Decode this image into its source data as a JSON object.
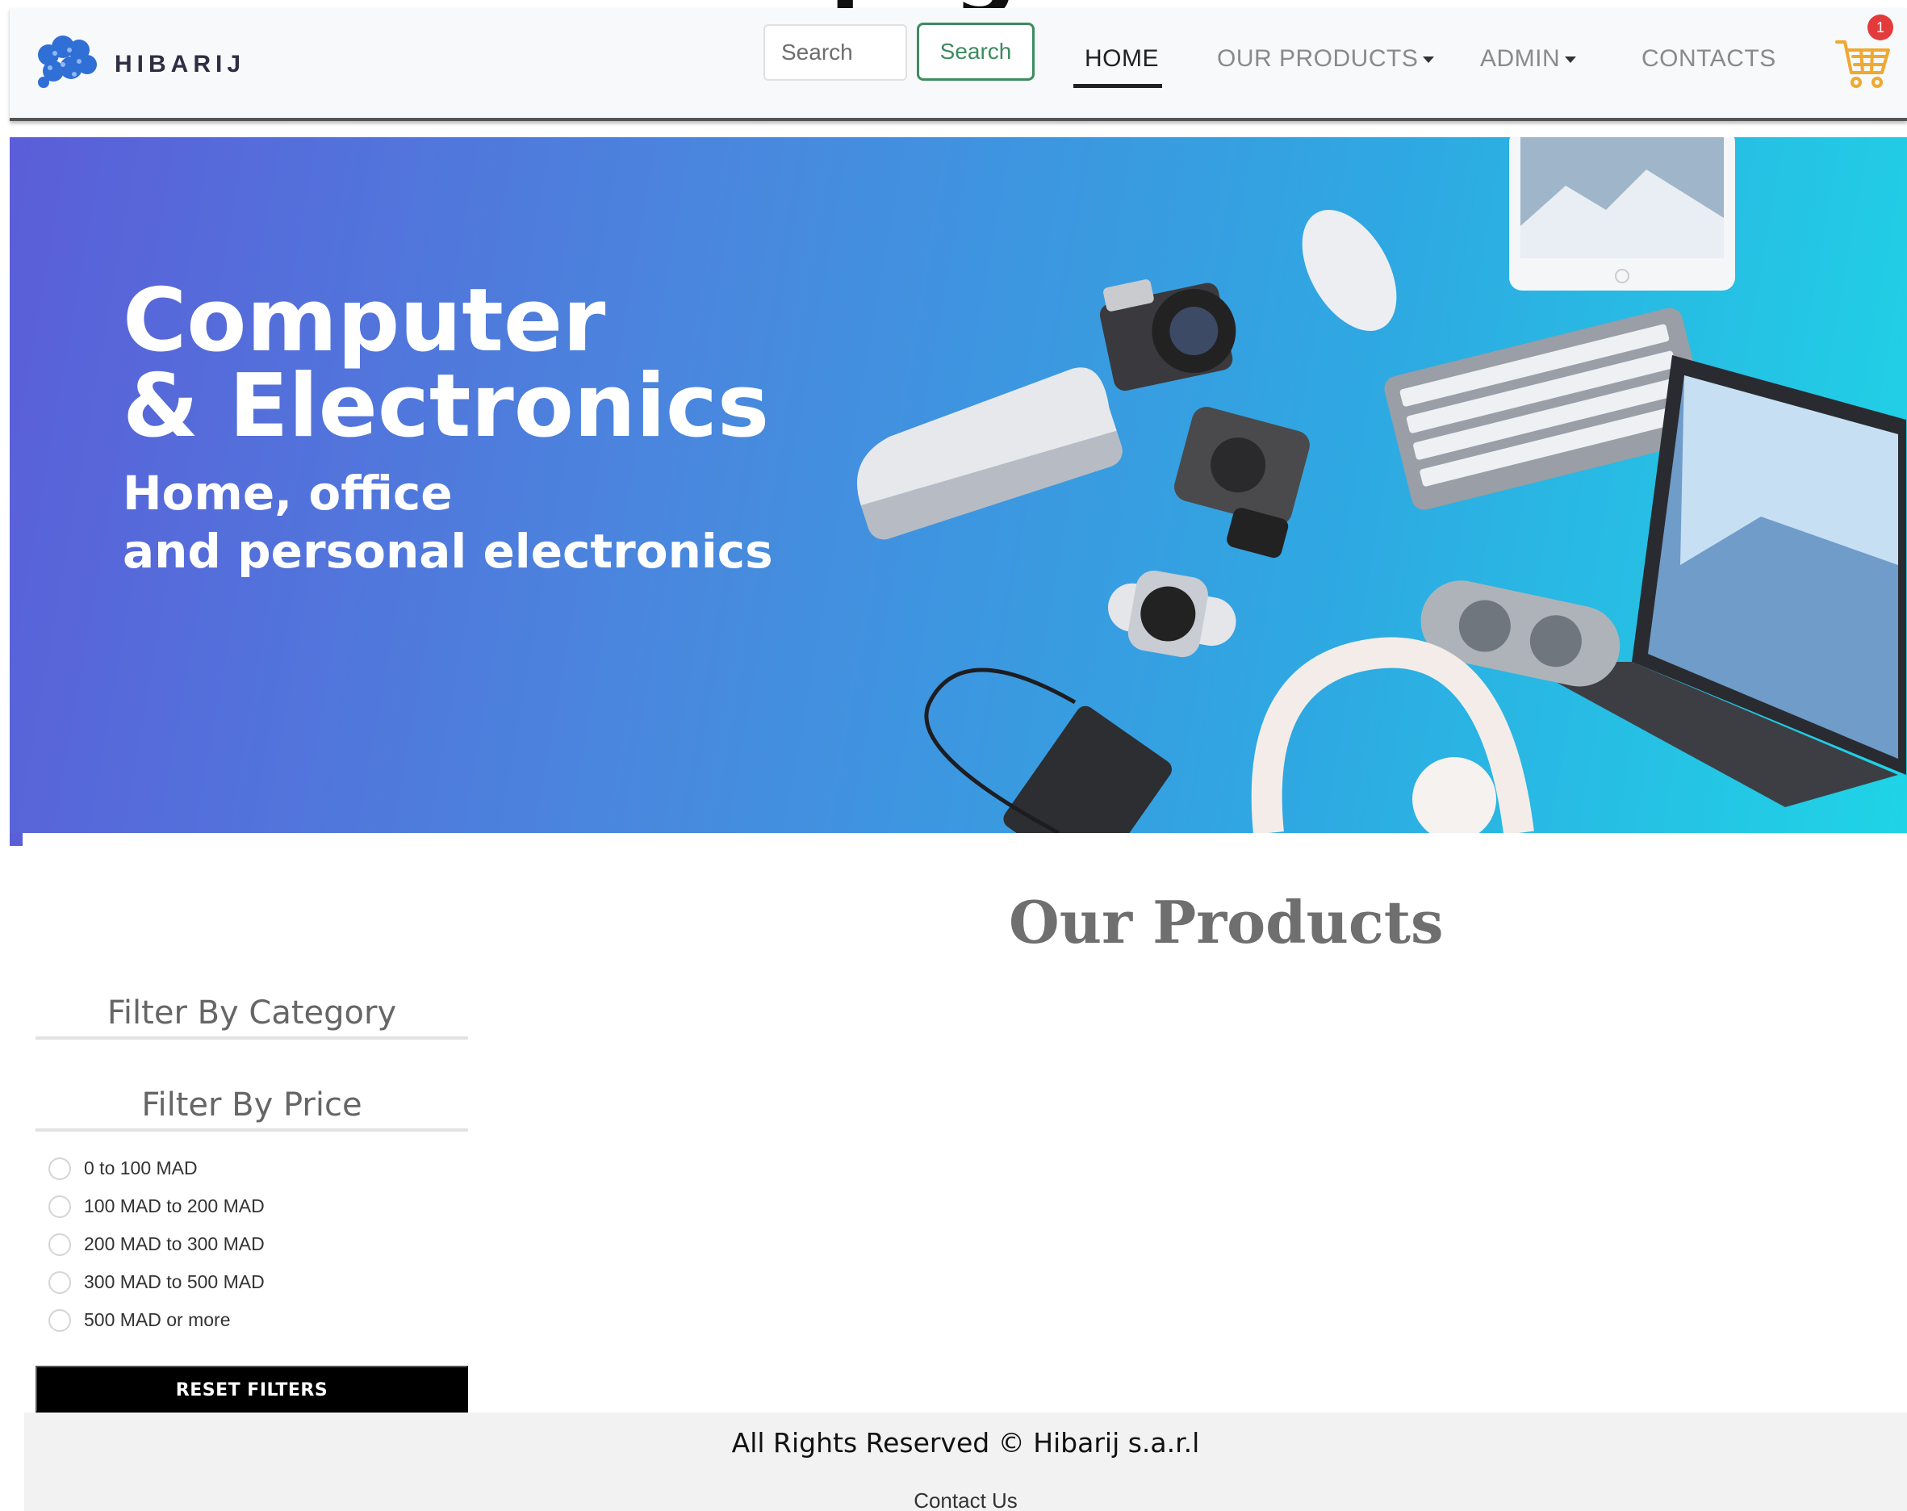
{
  "brand": {
    "name": "HIBARIJ"
  },
  "header_crop": "page",
  "search": {
    "placeholder": "Search",
    "button_label": "Search"
  },
  "nav": {
    "home": "HOME",
    "products": "OUR PRODUCTS",
    "admin": "ADMIN",
    "contacts": "CONTACTS"
  },
  "cart": {
    "count": "1",
    "icon": "cart-icon"
  },
  "hero": {
    "title_line1": "Computer",
    "title_line2": "& Electronics",
    "subtitle_line1": "Home, office",
    "subtitle_line2": "and personal electronics"
  },
  "products": {
    "heading": "Our Products"
  },
  "filters": {
    "category_heading": "Filter By Category",
    "price_heading": "Filter By Price",
    "price_options": [
      "0 to 100 MAD",
      "100 MAD to 200 MAD",
      "200 MAD to 300 MAD",
      "300 MAD to 500 MAD",
      "500 MAD or more"
    ],
    "reset_label": "RESET FILTERS"
  },
  "footer": {
    "rights": "All Rights Reserved © Hibarij s.a.r.l",
    "contact_link": "Contact Us"
  },
  "colors": {
    "accent_green": "#3d8b5f",
    "badge_red": "#e33b3b",
    "cart_orange": "#f0a830"
  }
}
